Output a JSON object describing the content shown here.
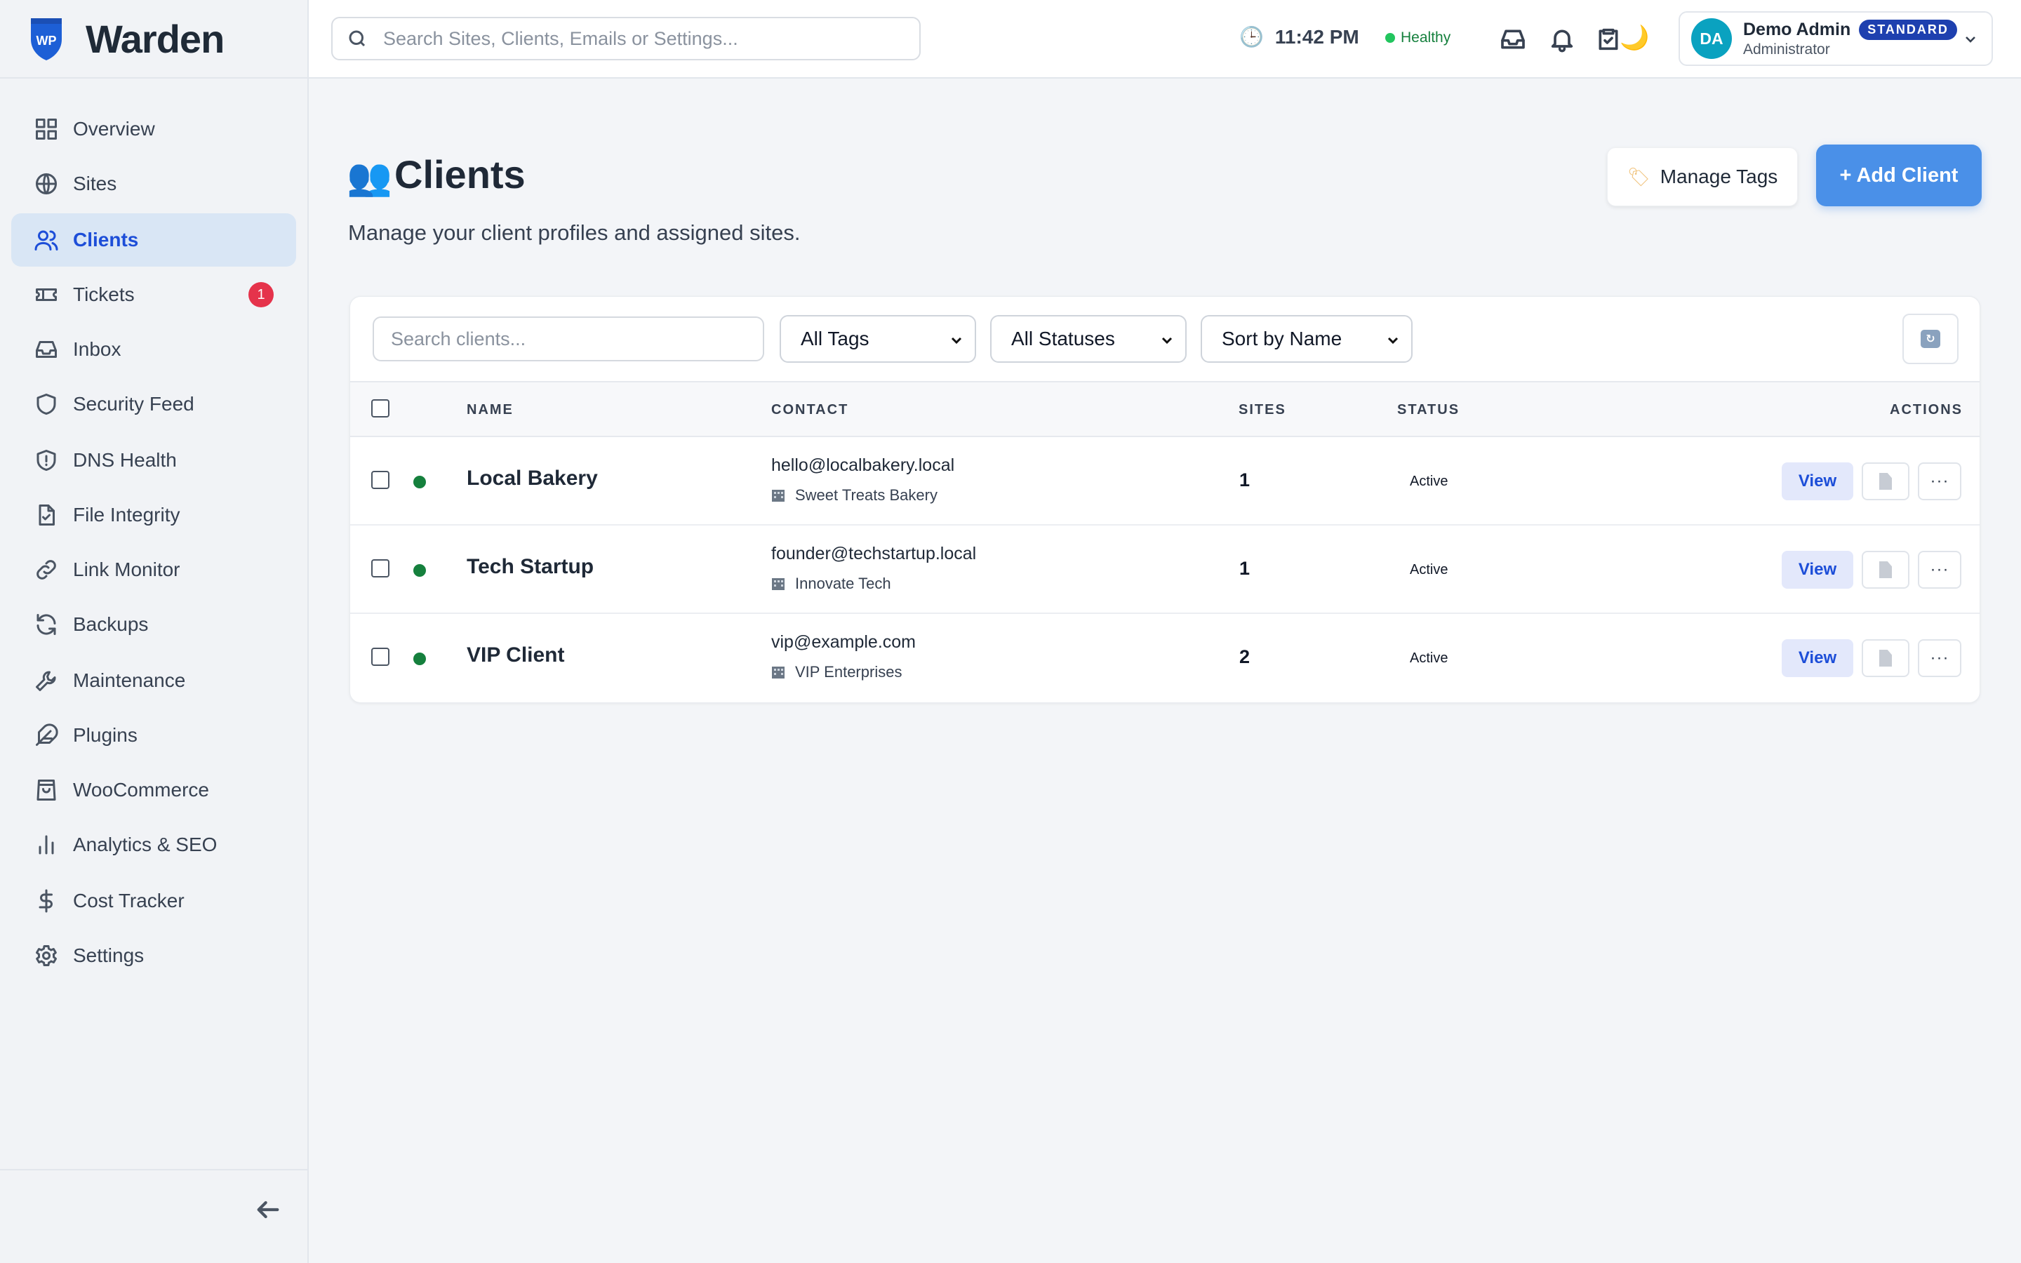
{
  "brand": {
    "name": "Warden",
    "logo_text": "WP"
  },
  "sidebar": {
    "items": [
      {
        "label": "Overview",
        "icon": "grid-icon"
      },
      {
        "label": "Sites",
        "icon": "globe-icon"
      },
      {
        "label": "Clients",
        "icon": "users-icon",
        "active": true
      },
      {
        "label": "Tickets",
        "icon": "ticket-icon",
        "badge": "1"
      },
      {
        "label": "Inbox",
        "icon": "inbox-icon"
      },
      {
        "label": "Security Feed",
        "icon": "shield-icon"
      },
      {
        "label": "DNS Health",
        "icon": "shield-alert-icon"
      },
      {
        "label": "File Integrity",
        "icon": "file-check-icon"
      },
      {
        "label": "Link Monitor",
        "icon": "link-icon"
      },
      {
        "label": "Backups",
        "icon": "refresh-icon"
      },
      {
        "label": "Maintenance",
        "icon": "wrench-icon"
      },
      {
        "label": "Plugins",
        "icon": "feather-icon"
      },
      {
        "label": "WooCommerce",
        "icon": "shopping-bag-icon"
      },
      {
        "label": "Analytics & SEO",
        "icon": "bar-chart-icon"
      },
      {
        "label": "Cost Tracker",
        "icon": "dollar-icon"
      },
      {
        "label": "Settings",
        "icon": "gear-icon"
      }
    ]
  },
  "topbar": {
    "search_placeholder": "Search Sites, Clients, Emails or Settings...",
    "time": "11:42 PM",
    "health_status": "Healthy",
    "user": {
      "initials": "DA",
      "name": "Demo Admin",
      "plan": "STANDARD",
      "role": "Administrator"
    }
  },
  "page": {
    "title": "Clients",
    "subtitle": "Manage your client profiles and assigned sites.",
    "manage_tags_label": "Manage Tags",
    "add_client_label": "+ Add Client"
  },
  "filters": {
    "search_placeholder": "Search clients...",
    "tags_value": "All Tags",
    "status_value": "All Statuses",
    "sort_value": "Sort by Name"
  },
  "table": {
    "headers": {
      "name": "NAME",
      "contact": "CONTACT",
      "sites": "SITES",
      "status": "STATUS",
      "actions": "ACTIONS"
    },
    "view_label": "View",
    "more_label": "···",
    "rows": [
      {
        "name": "Local Bakery",
        "email": "hello@localbakery.local",
        "company": "Sweet Treats Bakery",
        "sites": "1",
        "status": "Active"
      },
      {
        "name": "Tech Startup",
        "email": "founder@techstartup.local",
        "company": "Innovate Tech",
        "sites": "1",
        "status": "Active"
      },
      {
        "name": "VIP Client",
        "email": "vip@example.com",
        "company": "VIP Enterprises",
        "sites": "2",
        "status": "Active"
      }
    ]
  },
  "colors": {
    "accent": "#1d4ed8",
    "primary_button": "#4a90e8",
    "active_dot": "#15803d",
    "badge": "#e5334b"
  }
}
